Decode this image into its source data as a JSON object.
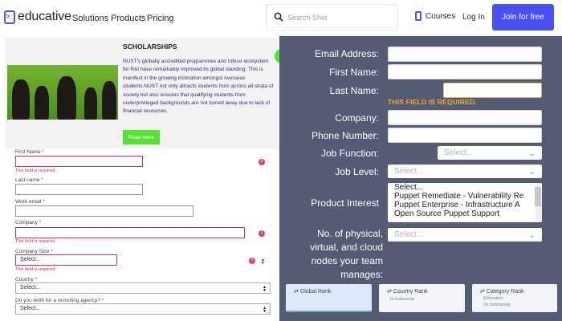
{
  "nav": {
    "logo_text": "educative",
    "links": [
      "Solutions",
      "Products",
      "Pricing"
    ],
    "search_placeholder": "Search Shot",
    "courses": "Courses",
    "login": "Log In",
    "join": "Join for free",
    "accent": "#4951f5"
  },
  "scholarship": {
    "title": "SCHOLARSHIPS",
    "body": "NUST's globally accredited programmes and robust ecosystem for R&I have remarkably improved its global standing. This is manifest in the growing inclination amongst overseas students.NUST not only attracts students from across all strata of society but also ensures that qualifying students from underprivileged backgrounds are not turned away due to lack of financial resources.",
    "read_more": "Read more"
  },
  "left_form": {
    "first_name": "First Name",
    "last_name": "Last name",
    "work_email": "Work email",
    "company": "Company",
    "company_size": "Company Size",
    "company_size_value": "Select...",
    "country": "Country",
    "country_value": "Select...",
    "recruiting": "Do you work for a recruiting agency?",
    "recruiting_value": "Select...",
    "required_marker": "*",
    "error_text": "This field is required.",
    "error_color": "#cf2b49"
  },
  "right_form": {
    "email": "Email Address:",
    "first": "First Name:",
    "last": "Last Name:",
    "required_msg": "THIS FIELD IS REQUIRED.",
    "company": "Company:",
    "phone": "Phone Number:",
    "job_function": "Job Function:",
    "job_function_value": "Select...",
    "job_level": "Job Level:",
    "job_level_value": "Select...",
    "product_interest": "Product Interest",
    "products": [
      "Select...",
      "Puppet Remediate - Vulnerability Re",
      "Puppet Enterprise - Infrastructure A",
      "Open Source Puppet Support"
    ],
    "nodes_label": "No. of physical, virtual, and cloud nodes your team manages:",
    "nodes_value": "Select...",
    "background": "#545b73",
    "warning_color": "#e9a934"
  },
  "ranks": {
    "global": "Global Rank",
    "country": "Country Rank",
    "country_sub": "In Indonesia",
    "category": "Category Rank",
    "category_sub1": "Education",
    "category_sub2": "(In Indonesia)"
  }
}
